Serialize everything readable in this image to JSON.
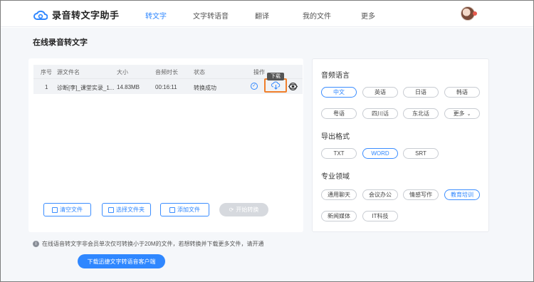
{
  "app": {
    "name": "录音转文字助手"
  },
  "nav": [
    {
      "label": "转文字",
      "active": true
    },
    {
      "label": "文字转语音",
      "active": false
    },
    {
      "label": "翻译",
      "active": false
    },
    {
      "label": "我的文件",
      "active": false
    },
    {
      "label": "更多",
      "active": false
    }
  ],
  "page": {
    "title": "在线录音转文字"
  },
  "table": {
    "headers": [
      "序号",
      "源文件名",
      "大小",
      "音频时长",
      "状态",
      "操作"
    ],
    "rows": [
      {
        "index": "1",
        "filename": "诊断[李]_课堂实录_1...",
        "size": "14.83MB",
        "duration": "00:16:11",
        "status": "转换成功"
      }
    ],
    "tooltip": "下载"
  },
  "actions": {
    "clear": "清空文件",
    "select_folder": "选择文件夹",
    "add_file": "添加文件",
    "start": "开始转换"
  },
  "settings": {
    "language_title": "音频语言",
    "languages": [
      "中文",
      "英语",
      "日语",
      "韩语",
      "粤语",
      "四川话",
      "东北话",
      "更多"
    ],
    "language_selected": "中文",
    "format_title": "导出格式",
    "formats": [
      "TXT",
      "WORD",
      "SRT"
    ],
    "format_selected": "WORD",
    "domain_title": "专业领域",
    "domains": [
      "通用聊天",
      "会议办公",
      "情感写作",
      "教育培训",
      "新闻媒体",
      "IT科技"
    ],
    "domain_selected": "教育培训"
  },
  "notice": "在线语音转文字非会员单次仅可转换小于20M的文件，若想转换并下载更多文件，请开通",
  "cta": "下载迅捷文字转语音客户端",
  "colors": {
    "accent": "#2f87ff",
    "highlight": "#f07f2b"
  }
}
